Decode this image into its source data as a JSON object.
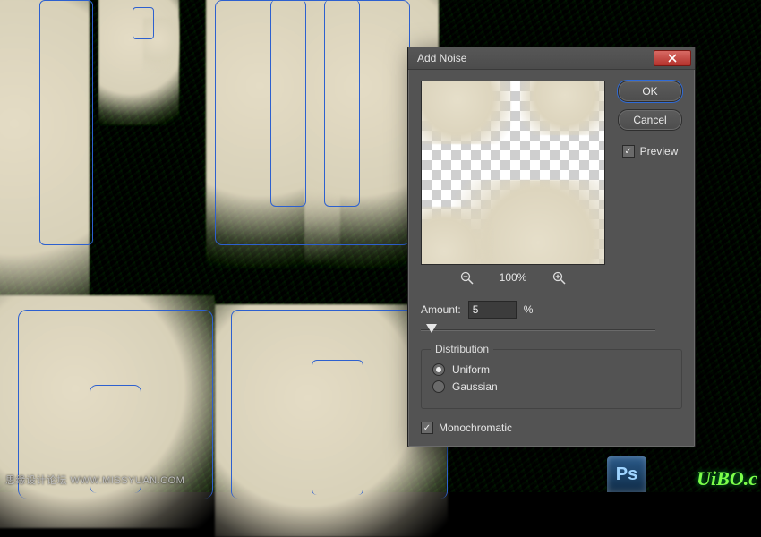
{
  "dialog": {
    "title": "Add Noise",
    "ok": "OK",
    "cancel": "Cancel",
    "preview_label": "Preview",
    "preview_checked": true,
    "zoom": "100%",
    "amount_label": "Amount:",
    "amount_value": "5",
    "amount_unit": "%",
    "distribution": {
      "title": "Distribution",
      "uniform": "Uniform",
      "gaussian": "Gaussian",
      "selected": "uniform"
    },
    "mono_label": "Monochromatic",
    "mono_checked": true
  },
  "watermark": {
    "left": "思缘设计论坛  WWW.MISSYUAN.COM",
    "right_logo": "Ps",
    "right_text": "UiBO.c"
  }
}
